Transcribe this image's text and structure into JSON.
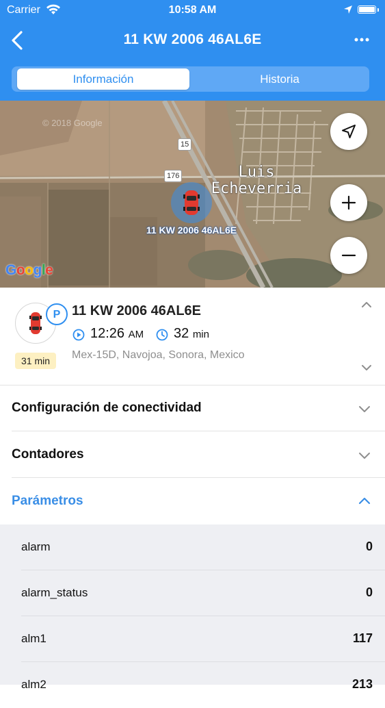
{
  "status_bar": {
    "carrier": "Carrier",
    "time": "10:58 AM"
  },
  "nav": {
    "title": "11 KW 2006 46AL6E"
  },
  "tabs": [
    {
      "label": "Información",
      "active": true
    },
    {
      "label": "Historia",
      "active": false
    }
  ],
  "map": {
    "town_label_line1": "Luis",
    "town_label_line2": "Echeverria",
    "vehicle_label": "11 KW 2006 46AL6E",
    "road_badges": [
      "15",
      "176"
    ],
    "copyright": "© 2018 Google",
    "google_logo": "Google"
  },
  "vehicle": {
    "name": "11 KW 2006 46AL6E",
    "status_icon_letter": "P",
    "stop_duration_badge": "31 min",
    "time": "12:26",
    "time_suffix": "AM",
    "duration_value": "32",
    "duration_unit": "min",
    "address": "Mex-15D, Navojoa, Sonora, Mexico"
  },
  "sections": [
    {
      "label": "Configuración de conectividad",
      "expanded": false
    },
    {
      "label": "Contadores",
      "expanded": false
    },
    {
      "label": "Parámetros",
      "expanded": true
    }
  ],
  "parameters": [
    {
      "name": "alarm",
      "value": "0"
    },
    {
      "name": "alarm_status",
      "value": "0"
    },
    {
      "name": "alm1",
      "value": "117"
    },
    {
      "name": "alm2",
      "value": "213"
    }
  ],
  "colors": {
    "header_blue": "#2f8ff0",
    "accent_blue": "#3a8ee6",
    "badge_yellow": "#fdf0c2",
    "param_bg": "#eeeff3"
  }
}
